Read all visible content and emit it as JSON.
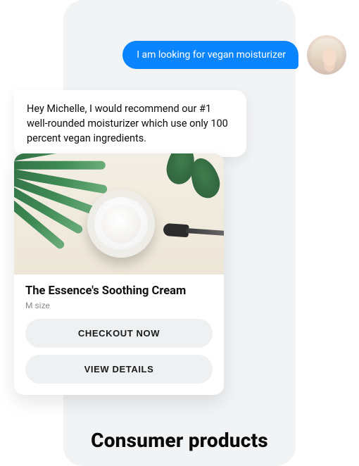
{
  "chat": {
    "user_message": "I am looking for vegan moisturizer",
    "bot_reply": "Hey Michelle, I would recommend our #1 well-rounded moisturizer which use only 100 percent vegan ingredients."
  },
  "product": {
    "title": "The Essence's Soothing Cream",
    "subtitle": "M size",
    "buttons": {
      "checkout": "CHECKOUT NOW",
      "details": "VIEW DETAILS"
    }
  },
  "footer": {
    "headline": "Consumer products"
  }
}
